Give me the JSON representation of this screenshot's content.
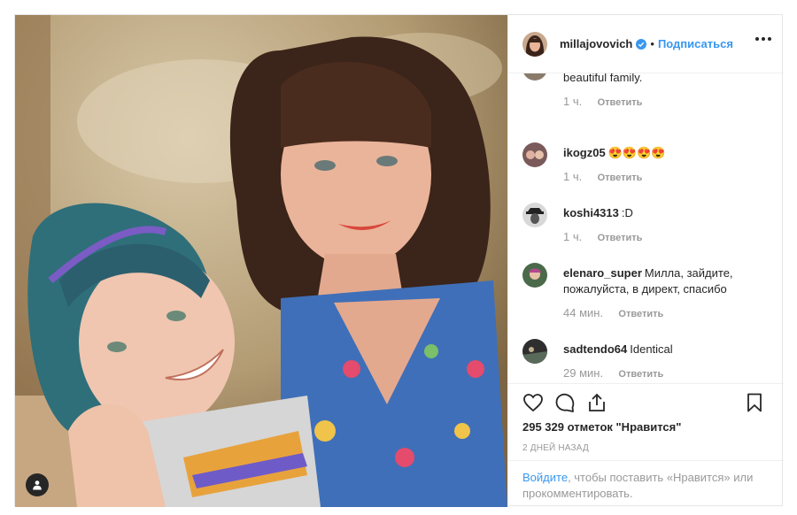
{
  "post": {
    "username": "millajovovich",
    "separator": "•",
    "follow_label": "Подписаться"
  },
  "comments": [
    {
      "user": "",
      "text": "beautiful family.",
      "time": "1 ч.",
      "reply": "Ответить"
    },
    {
      "user": "ikogz05",
      "text": "😍😍😍😍",
      "time": "1 ч.",
      "reply": "Ответить"
    },
    {
      "user": "koshi4313",
      "text": ":D",
      "time": "1 ч.",
      "reply": "Ответить"
    },
    {
      "user": "elenaro_super",
      "text": "Милла, зайдите, пожалуйста, в директ, спасибо",
      "time": "44 мин.",
      "reply": "Ответить"
    },
    {
      "user": "sadtendo64",
      "text": "Identical",
      "time": "29 мин.",
      "reply": "Ответить"
    }
  ],
  "likes": "295 329 отметок \"Нравится\"",
  "posted": "2 ДНЕЙ НАЗАД",
  "login": {
    "link": "Войдите",
    "rest": ", чтобы поставить «Нравится» или прокомментировать."
  },
  "icons": {
    "like": "heart-icon",
    "comment": "comment-icon",
    "share": "share-icon",
    "save": "bookmark-icon",
    "verified": "verified-badge-icon",
    "more": "more-options-icon",
    "tag": "user-tag-icon"
  },
  "colors": {
    "accent": "#3897f0",
    "text": "#262626",
    "muted": "#999999",
    "border": "#efefef"
  }
}
